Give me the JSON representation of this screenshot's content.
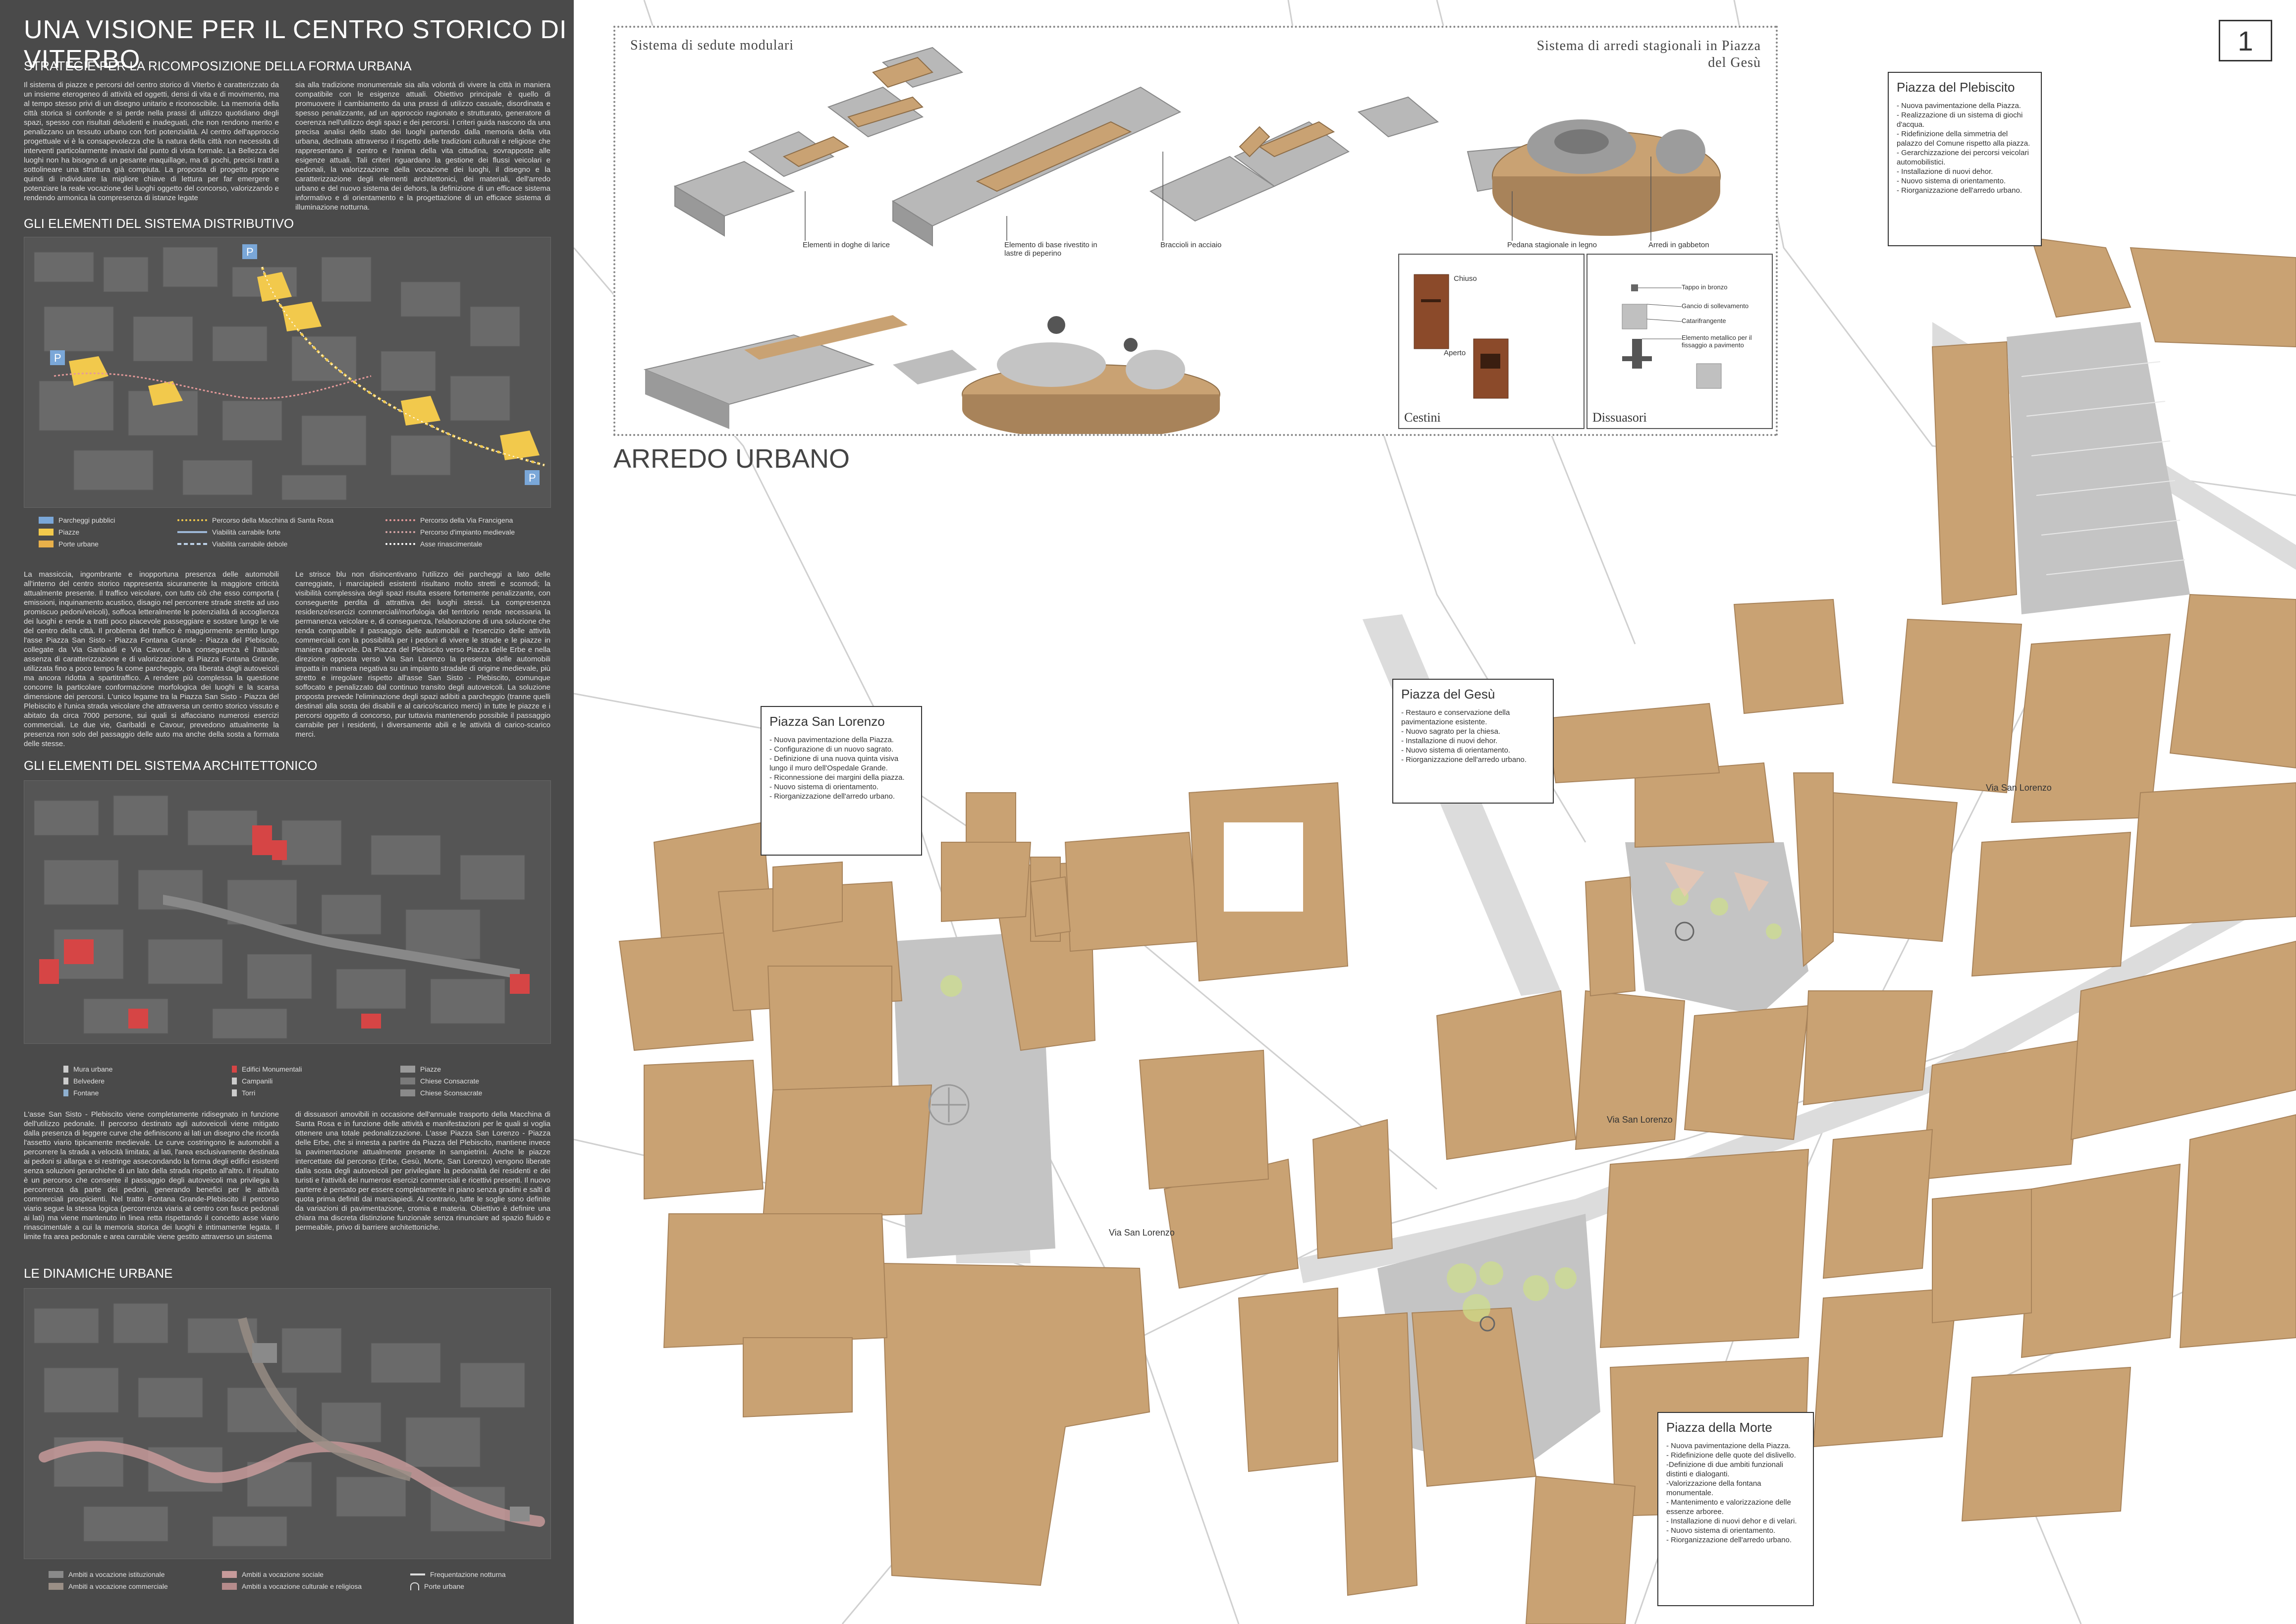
{
  "title": "UNA VISIONE PER IL CENTRO STORICO DI VITERBO",
  "sheet_number": "1",
  "sidebar": {
    "sec1_title": "STRATEGIE PER LA RICOMPOSIZIONE DELLA FORMA URBANA",
    "sec1_col1": "Il sistema di piazze e percorsi del centro storico di Viterbo è caratterizzato da un insieme eterogeneo di attività ed oggetti, densi di vita e di movimento, ma al tempo stesso privi di un disegno unitario e riconoscibile. La memoria della città storica si confonde e si perde nella prassi di utilizzo quotidiano degli spazi, spesso con risultati deludenti e inadeguati, che non rendono merito e penalizzano un tessuto urbano con forti potenzialità. Al centro dell'approccio progettuale vi è la consapevolezza che la natura della città non necessita di interventi particolarmente invasivi dal punto di vista formale. La Bellezza dei luoghi non ha bisogno di un pesante maquillage, ma di pochi, precisi tratti a sottolineare una struttura già compiuta. La proposta di progetto propone quindi di individuare la migliore chiave di lettura per far emergere e potenziare la reale vocazione dei luoghi oggetto del concorso, valorizzando e rendendo armonica la compresenza di istanze legate",
    "sec1_col2": "sia alla tradizione monumentale sia alla volontà di vivere la città in maniera compatibile con le esigenze attuali. Obiettivo principale è quello di promuovere il cambiamento da una prassi di utilizzo casuale, disordinata e spesso penalizzante, ad un approccio ragionato e strutturato, generatore di coerenza nell'utilizzo degli spazi e dei percorsi. I criteri guida nascono da una precisa analisi dello stato dei luoghi partendo dalla memoria della vita urbana, declinata attraverso il rispetto delle tradizioni culturali e religiose che rappresentano il centro e l'anima della vita cittadina, sovrapposte alle esigenze attuali. Tali criteri riguardano la gestione dei flussi veicolari e pedonali, la valorizzazione della vocazione dei luoghi, il disegno e la caratterizzazione degli elementi architettonici, dei materiali, dell'arredo urbano e del nuovo sistema dei dehors, la definizione di un efficace sistema informativo e di orientamento e la progettazione di un efficace sistema di illuminazione notturna.",
    "sec2_title": "GLI ELEMENTI DEL SISTEMA DISTRIBUTIVO",
    "legend1": [
      {
        "label": "Parcheggi pubblici",
        "color": "#7aa7d8"
      },
      {
        "label": "Piazze",
        "color": "#f2c94c"
      },
      {
        "label": "Porte urbane",
        "color": "#e8b04a"
      },
      {
        "label": "Percorso della Macchina di Santa Rosa",
        "color": "#f2c94c"
      },
      {
        "label": "Viabilità carrabile forte",
        "color": "#9db7d6"
      },
      {
        "label": "Viabilità carrabile debole",
        "color": "#bcd0e6"
      },
      {
        "label": "Percorso della Via Francigena",
        "color": "#e59a9a"
      },
      {
        "label": "Percorso d'impianto medievale",
        "color": "#d6a6a6"
      },
      {
        "label": "Asse rinascimentale",
        "color": "#ffffff"
      }
    ],
    "sec2_col1": "La massiccia, ingombrante e inopportuna presenza delle automobili all'interno del centro storico rappresenta sicuramente la maggiore criticità attualmente presente. Il traffico veicolare, con tutto ciò che esso comporta ( emissioni, inquinamento acustico, disagio nel percorrere strade strette ad uso promiscuo pedoni/veicoli), soffoca letteralmente le potenzialità di accoglienza dei luoghi e rende a tratti poco piacevole passeggiare e sostare lungo le vie del centro della città. Il problema del traffico è maggiormente sentito lungo l'asse Piazza San Sisto - Piazza Fontana Grande - Piazza del Plebiscito, collegate da Via Garibaldi e Via Cavour. Una conseguenza è l'attuale assenza di caratterizzazione e di valorizzazione di Piazza Fontana Grande, utilizzata fino a poco tempo fa come parcheggio, ora liberata dagli autoveicoli ma ancora ridotta a spartitraffico. A rendere più complessa la questione concorre la particolare conformazione morfologica dei luoghi e la scarsa dimensione dei percorsi. L'unico legame tra la Piazza San Sisto - Piazza del Plebiscito è l'unica strada veicolare che attraversa un centro storico vissuto e abitato da circa 7000 persone, sui quali si affacciano numerosi esercizi commerciali. Le due vie, Garibaldi e Cavour, prevedono attualmente la presenza non solo del passaggio delle auto ma anche della sosta a formata delle stesse.",
    "sec2_col2": "Le strisce blu non disincentivano l'utilizzo dei parcheggi a lato delle carreggiate, i marciapiedi esistenti risultano molto stretti e scomodi; la visibilità complessiva degli spazi risulta essere fortemente penalizzante, con conseguente perdita di attrattiva dei luoghi stessi. La compresenza residenze/esercizi commerciali/morfologia del territorio rende necessaria la permanenza veicolare e, di conseguenza, l'elaborazione di una soluzione che renda compatibile il passaggio delle automobili e l'esercizio delle attività commerciali con la possibilità per i pedoni di vivere le strade e le piazze in maniera gradevole. Da Piazza del Plebiscito verso Piazza delle Erbe e nella direzione opposta verso Via San Lorenzo la presenza delle automobili impatta in maniera negativa su un impianto stradale di origine medievale, più stretto e irregolare rispetto all'asse San Sisto - Plebiscito, comunque soffocato e penalizzato dal continuo transito degli autoveicoli. La soluzione proposta prevede l'eliminazione degli spazi adibiti a parcheggio (tranne quelli destinati alla sosta dei disabili e al carico/scarico merci) in tutte le piazze e i percorsi oggetto di concorso, pur tuttavia mantenendo possibile il passaggio carrabile per i residenti, i diversamente abili e le attività di carico-scarico merci.",
    "sec3_title": "GLI ELEMENTI DEL SISTEMA ARCHITETTONICO",
    "legend2": [
      {
        "label": "Mura urbane",
        "color": "#cccccc"
      },
      {
        "label": "Belvedere",
        "color": "#cccccc"
      },
      {
        "label": "Fontane",
        "color": "#8fb0d0"
      },
      {
        "label": "Edifici Monumentali",
        "color": "#d64545"
      },
      {
        "label": "Campanili",
        "color": "#cccccc"
      },
      {
        "label": "Torri",
        "color": "#cccccc"
      },
      {
        "label": "Piazze",
        "color": "#9a9a9a"
      },
      {
        "label": "Chiese Consacrate",
        "color": "#7a7a7a"
      },
      {
        "label": "Chiese Sconsacrate",
        "color": "#8a8a8a"
      }
    ],
    "sec3_col1": "L'asse San Sisto - Plebiscito viene completamente ridisegnato in funzione dell'utilizzo pedonale. Il percorso destinato agli autoveicoli viene mitigato dalla presenza di leggere curve che definiscono ai lati un disegno che ricorda l'assetto viario tipicamente medievale. Le curve costringono le automobili a percorrere la strada a velocità limitata; ai lati, l'area esclusivamente destinata ai pedoni si allarga e si restringe assecondando la forma degli edifici esistenti senza soluzioni gerarchiche di un lato della strada rispetto all'altro. Il risultato è un percorso che consente il passaggio degli autoveicoli ma privilegia la percorrenza da parte dei pedoni, generando benefici per le attività commerciali prospicienti. Nel tratto Fontana Grande-Plebiscito il percorso viario segue la stessa logica (percorrenza viaria al centro con fasce pedonali ai lati) ma viene mantenuto in linea retta rispettando il concetto asse viario rinascimentale a cui la memoria storica dei luoghi è intimamente legata. Il limite fra area pedonale e area carrabile viene gestito attraverso un sistema",
    "sec3_col2": "di dissuasori amovibili in occasione dell'annuale trasporto della Macchina di Santa Rosa e in funzione delle attività e manifestazioni per le quali si voglia ottenere una totale pedonalizzazione. L'asse Piazza San Lorenzo - Piazza delle Erbe, che si innesta a partire da Piazza del Plebiscito, mantiene invece la pavimentazione attualmente presente in sampietrini. Anche le piazze intercettate dal percorso (Erbe, Gesù, Morte, San Lorenzo) vengono liberate dalla sosta degli autoveicoli per privilegiare la pedonalità dei residenti e dei turisti e l'attività dei numerosi esercizi commerciali e ricettivi presenti. Il nuovo parterre è pensato per essere completamente in piano senza gradini e salti di quota prima definiti dai marciapiedi. Al contrario, tutte le soglie sono definite da variazioni di pavimentazione, cromia e materia. Obiettivo è definire una chiara ma discreta distinzione funzionale senza rinunciare ad spazio fluido e permeabile, privo di barriere architettoniche.",
    "sec4_title": "LE DINAMICHE URBANE",
    "legend3": [
      {
        "label": "Ambiti a vocazione istituzionale",
        "color": "#8a8a8a"
      },
      {
        "label": "Ambiti a vocazione commerciale",
        "color": "#9a8f86"
      },
      {
        "label": "Ambiti a vocazione sociale",
        "color": "#c79a9a"
      },
      {
        "label": "Ambiti a vocazione culturale e religiosa",
        "color": "#b58b8b"
      },
      {
        "label": "Frequentazione notturna",
        "color": "#dddddd"
      },
      {
        "label": "Porte urbane",
        "color": "#dddddd"
      }
    ]
  },
  "furniture": {
    "title_left": "Sistema di sedute modulari",
    "title_right": "Sistema di arredi stagionali in Piazza del Gesù",
    "labels": [
      "Elementi in doghe di larice",
      "Elemento di base rivestito in lastre di peperino",
      "Braccioli in acciaio",
      "Pedana stagionale in legno",
      "Arredi in gabbeton"
    ],
    "cestini_title": "Cestini",
    "cestini_labels": [
      "Chiuso",
      "Aperto"
    ],
    "dissuasori_title": "Dissuasori",
    "dissuasori_labels": [
      "Tappo in bronzo",
      "Gancio di sollevamento",
      "Catarifrangente",
      "Elemento metallico per il fissaggio a pavimento"
    ]
  },
  "arredo_title": "ARREDO URBANO",
  "callouts": {
    "plebiscito": {
      "title": "Piazza del Plebiscito",
      "items": [
        "- Nuova pavimentazione della Piazza.",
        "- Realizzazione di un sistema di giochi d'acqua.",
        "- Ridefinizione della simmetria del palazzo del Comune rispetto alla piazza.",
        "- Gerarchizzazione dei percorsi veicolari automobilistici.",
        "- Installazione di nuovi dehor.",
        "- Nuovo sistema di orientamento.",
        "- Riorganizzazione dell'arredo urbano."
      ]
    },
    "gesu": {
      "title": "Piazza del Gesù",
      "items": [
        "- Restauro e conservazione della pavimentazione esistente.",
        "- Nuovo sagrato per la chiesa.",
        "- Installazione di nuovi dehor.",
        "- Nuovo sistema di orientamento.",
        "- Riorganizzazione dell'arredo urbano."
      ]
    },
    "sanlorenzo": {
      "title": "Piazza San Lorenzo",
      "items": [
        "- Nuova pavimentazione della Piazza.",
        "- Configurazione di un nuovo sagrato.",
        "- Definizione di una nuova quinta visiva lungo il muro dell'Ospedale Grande.",
        "- Riconnessione dei margini della piazza.",
        "- Nuovo sistema di orientamento.",
        "- Riorganizzazione dell'arredo urbano."
      ]
    },
    "morte": {
      "title": "Piazza della Morte",
      "items": [
        "- Nuova pavimentazione della Piazza.",
        "- Ridefinizione delle quote del dislivello.",
        "-Definizione di due ambiti funzionali distinti e dialoganti.",
        "-Valorizzazione della fontana monumentale.",
        "- Mantenimento e valorizzazione delle essenze arboree.",
        "- Installazione di nuovi dehor e di velari.",
        "- Nuovo sistema di orientamento.",
        "- Riorganizzazione dell'arredo urbano."
      ]
    }
  },
  "streets": [
    "Via San Lorenzo",
    "Via San Lorenzo",
    "Via San Lorenzo"
  ]
}
